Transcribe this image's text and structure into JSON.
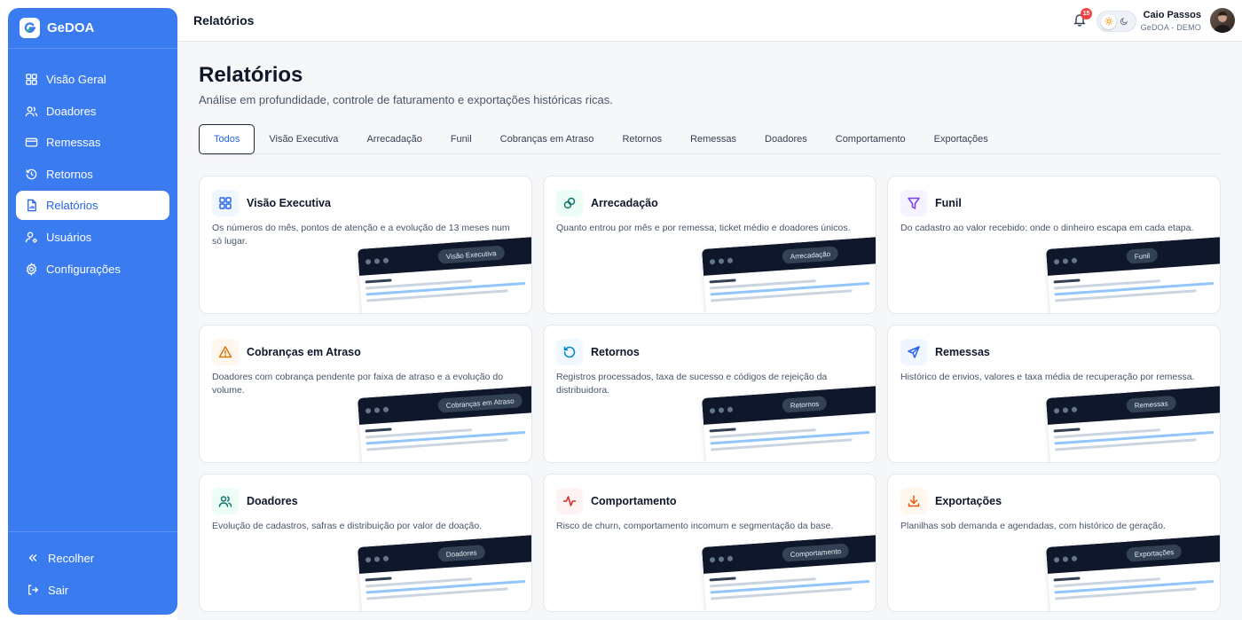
{
  "brand": {
    "name": "GeDOA"
  },
  "sidebar": {
    "items": [
      {
        "label": "Visão Geral",
        "icon": "grid-icon"
      },
      {
        "label": "Doadores",
        "icon": "users-icon"
      },
      {
        "label": "Remessas",
        "icon": "credit-card-icon"
      },
      {
        "label": "Retornos",
        "icon": "history-icon"
      },
      {
        "label": "Relatórios",
        "icon": "report-icon",
        "active": true
      },
      {
        "label": "Usuários",
        "icon": "user-cog-icon"
      },
      {
        "label": "Configurações",
        "icon": "gear-icon"
      }
    ],
    "collapse_label": "Recolher",
    "logout_label": "Sair"
  },
  "topbar": {
    "title": "Relatórios",
    "notification_count": "15",
    "user_name": "Caio Passos",
    "user_org": "GeDOA - DEMO"
  },
  "main": {
    "title": "Relatórios",
    "subtitle": "Análise em profundidade, controle de faturamento e exportações históricas ricas.",
    "tabs": [
      "Todos",
      "Visão Executiva",
      "Arrecadação",
      "Funil",
      "Cobranças em Atraso",
      "Retornos",
      "Remessas",
      "Doadores",
      "Comportamento",
      "Exportações"
    ],
    "cards": [
      {
        "title": "Visão Executiva",
        "desc": "Os números do mês, pontos de atenção e a evolução de 13 meses num só lugar.",
        "preview": "Visão Executiva",
        "icon": "grid-icon",
        "color": "#2563eb",
        "bg": "#eff6ff"
      },
      {
        "title": "Arrecadação",
        "desc": "Quanto entrou por mês e por remessa, ticket médio e doadores únicos.",
        "preview": "Arrecadação",
        "icon": "coins-icon",
        "color": "#0f766e",
        "bg": "#ecfdf5"
      },
      {
        "title": "Funil",
        "desc": "Do cadastro ao valor recebido: onde o dinheiro escapa em cada etapa.",
        "preview": "Funil",
        "icon": "funnel-icon",
        "color": "#7c3aed",
        "bg": "#f5f3ff"
      },
      {
        "title": "Cobranças em Atraso",
        "desc": "Doadores com cobrança pendente por faixa de atraso e a evolução do volume.",
        "preview": "Cobranças em Atraso",
        "icon": "warning-icon",
        "color": "#d97706",
        "bg": "#fff7ed"
      },
      {
        "title": "Retornos",
        "desc": "Registros processados, taxa de sucesso e códigos de rejeição da distribuidora.",
        "preview": "Retornos",
        "icon": "history-icon",
        "color": "#0284c7",
        "bg": "#f0f9ff"
      },
      {
        "title": "Remessas",
        "desc": "Histórico de envios, valores e taxa média de recuperação por remessa.",
        "preview": "Remessas",
        "icon": "send-icon",
        "color": "#2563eb",
        "bg": "#eff6ff"
      },
      {
        "title": "Doadores",
        "desc": "Evolução de cadastros, safras e distribuição por valor de doação.",
        "preview": "Doadores",
        "icon": "users-icon",
        "color": "#0f766e",
        "bg": "#ecfdf5"
      },
      {
        "title": "Comportamento",
        "desc": "Risco de churn, comportamento incomum e segmentação da base.",
        "preview": "Comportamento",
        "icon": "activity-icon",
        "color": "#dc2626",
        "bg": "#fef2f2"
      },
      {
        "title": "Exportações",
        "desc": "Planilhas sob demanda e agendadas, com histórico de geração.",
        "preview": "Exportações",
        "icon": "download-icon",
        "color": "#ea580c",
        "bg": "#fff7ed"
      }
    ]
  }
}
